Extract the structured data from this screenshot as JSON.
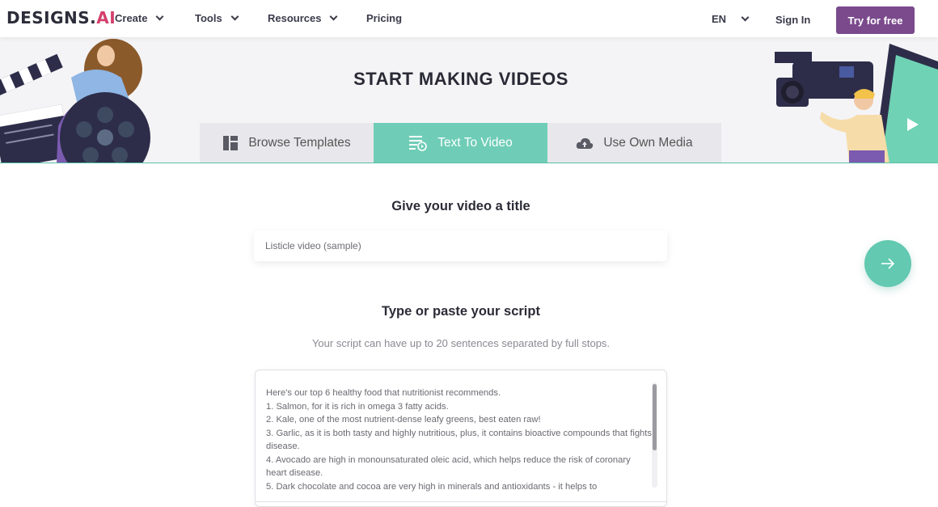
{
  "nav": {
    "logo_text": "DESIGNS.",
    "logo_accent": "AI",
    "items": [
      {
        "label": "Create"
      },
      {
        "label": "Tools"
      },
      {
        "label": "Resources"
      },
      {
        "label": "Pricing"
      }
    ],
    "language": "EN",
    "sign_in": "Sign In",
    "try_free": "Try for free"
  },
  "hero": {
    "title": "START MAKING VIDEOS",
    "tabs": [
      {
        "label": "Browse Templates",
        "icon": "template-grid-icon",
        "active": false
      },
      {
        "label": "Text To Video",
        "icon": "text-document-icon",
        "active": true
      },
      {
        "label": "Use Own Media",
        "icon": "cloud-upload-icon",
        "active": false
      }
    ]
  },
  "form": {
    "title_heading": "Give your video a title",
    "title_value": "Listicle video (sample)",
    "script_heading": "Type or paste your script",
    "script_hint": "Your script can have up to 20 sentences separated by full stops.",
    "script_value": "Here's our top 6 healthy food that nutritionist recommends.\n1. Salmon, for it is rich in omega 3 fatty acids.\n2. Kale, one of the most nutrient-dense leafy greens, best eaten raw!\n3. Garlic, as it is both tasty and highly nutritious, plus, it contains bioactive compounds that fights disease.\n4. Avocado are high in monounsaturated oleic acid, which helps reduce the risk of coronary heart disease.\n5. Dark chocolate and cocoa are very high in minerals and antioxidants - it helps to"
  },
  "colors": {
    "brand_purple": "#7a4a8c",
    "accent_teal": "#6fcdb7",
    "logo_red": "#d43f6b"
  }
}
